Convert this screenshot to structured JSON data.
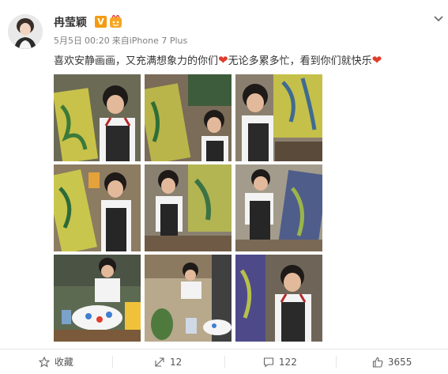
{
  "post": {
    "username": "冉莹颖",
    "verified_badge": "V",
    "level_badge_icon": "member-badge-icon",
    "date": "5月5日",
    "time": "00:20",
    "source_prefix": "来自",
    "source": "iPhone 7 Plus",
    "text_parts": [
      "喜欢安静画画，又充满想象力的你们",
      "无论多累多忙，看到你们就快乐"
    ],
    "heart_icon": "❤",
    "photo_count": 9
  },
  "actions": {
    "favorite_label": "收藏",
    "repost_count": "12",
    "comment_count": "122",
    "like_count": "3655"
  },
  "colors": {
    "accent_orange": "#f39c12",
    "heart_red": "#e03d2c",
    "muted_text": "#808080"
  }
}
